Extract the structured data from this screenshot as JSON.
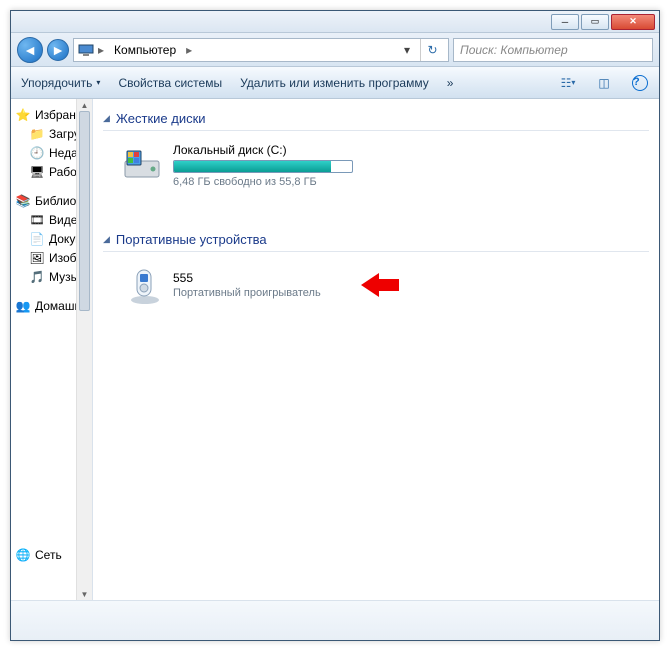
{
  "address": {
    "location": "Компьютер",
    "search_placeholder": "Поиск: Компьютер"
  },
  "toolbar": {
    "organize": "Упорядочить",
    "properties": "Свойства системы",
    "uninstall": "Удалить или изменить программу",
    "overflow": "»"
  },
  "nav": {
    "favorites": "Избранное",
    "downloads": "Загрузки",
    "recent": "Недавние места",
    "desktop": "Рабочий стол",
    "libraries": "Библиотеки",
    "videos": "Видео",
    "documents": "Документы",
    "pictures": "Изображения",
    "music": "Музыка",
    "homegroup": "Домашняя группа",
    "network": "Сеть"
  },
  "groups": {
    "hdd": "Жесткие диски",
    "portable": "Портативные устройства"
  },
  "drive_c": {
    "name": "Локальный диск (C:)",
    "free": "6,48 ГБ свободно из 55,8 ГБ",
    "used_pct": 88
  },
  "device": {
    "name": "555",
    "type": "Портативный проигрыватель"
  }
}
